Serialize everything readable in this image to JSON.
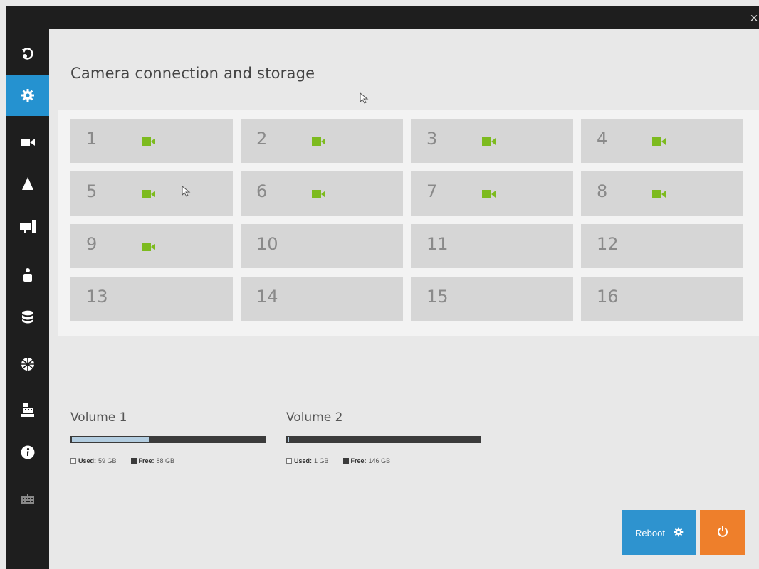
{
  "window": {
    "close_glyph": "×"
  },
  "sidebar": {
    "items": [
      {
        "name": "playback-icon",
        "active": false
      },
      {
        "name": "gear-icon",
        "active": true
      },
      {
        "name": "camera-icon",
        "active": false
      },
      {
        "name": "alert-icon",
        "active": false
      },
      {
        "name": "monitor-icon",
        "active": false
      },
      {
        "name": "user-icon",
        "active": false
      },
      {
        "name": "database-icon",
        "active": false
      },
      {
        "name": "network-icon",
        "active": false
      },
      {
        "name": "cash-register-icon",
        "active": false
      },
      {
        "name": "info-icon",
        "active": false
      },
      {
        "name": "keyboard-icon",
        "active": false
      }
    ]
  },
  "main": {
    "title": "Camera connection and storage",
    "channels": [
      {
        "number": "1",
        "camera_connected": true
      },
      {
        "number": "2",
        "camera_connected": true
      },
      {
        "number": "3",
        "camera_connected": true
      },
      {
        "number": "4",
        "camera_connected": true
      },
      {
        "number": "5",
        "camera_connected": true
      },
      {
        "number": "6",
        "camera_connected": true
      },
      {
        "number": "7",
        "camera_connected": true
      },
      {
        "number": "8",
        "camera_connected": true
      },
      {
        "number": "9",
        "camera_connected": true
      },
      {
        "number": "10",
        "camera_connected": false
      },
      {
        "number": "11",
        "camera_connected": false
      },
      {
        "number": "12",
        "camera_connected": false
      },
      {
        "number": "13",
        "camera_connected": false
      },
      {
        "number": "14",
        "camera_connected": false
      },
      {
        "number": "15",
        "camera_connected": false
      },
      {
        "number": "16",
        "camera_connected": false
      }
    ],
    "volumes": [
      {
        "label": "Volume 1",
        "used_label": "Used:",
        "used_value": "59 GB",
        "free_label": "Free:",
        "free_value": "88 GB",
        "used_fraction": 0.4
      },
      {
        "label": "Volume 2",
        "used_label": "Used:",
        "used_value": "1 GB",
        "free_label": "Free:",
        "free_value": "146 GB",
        "used_fraction": 0.007
      }
    ],
    "reboot_label": "Reboot"
  },
  "colors": {
    "accent": "#2592d0",
    "camera_green": "#7dbb1f",
    "power": "#ee7f2b"
  }
}
